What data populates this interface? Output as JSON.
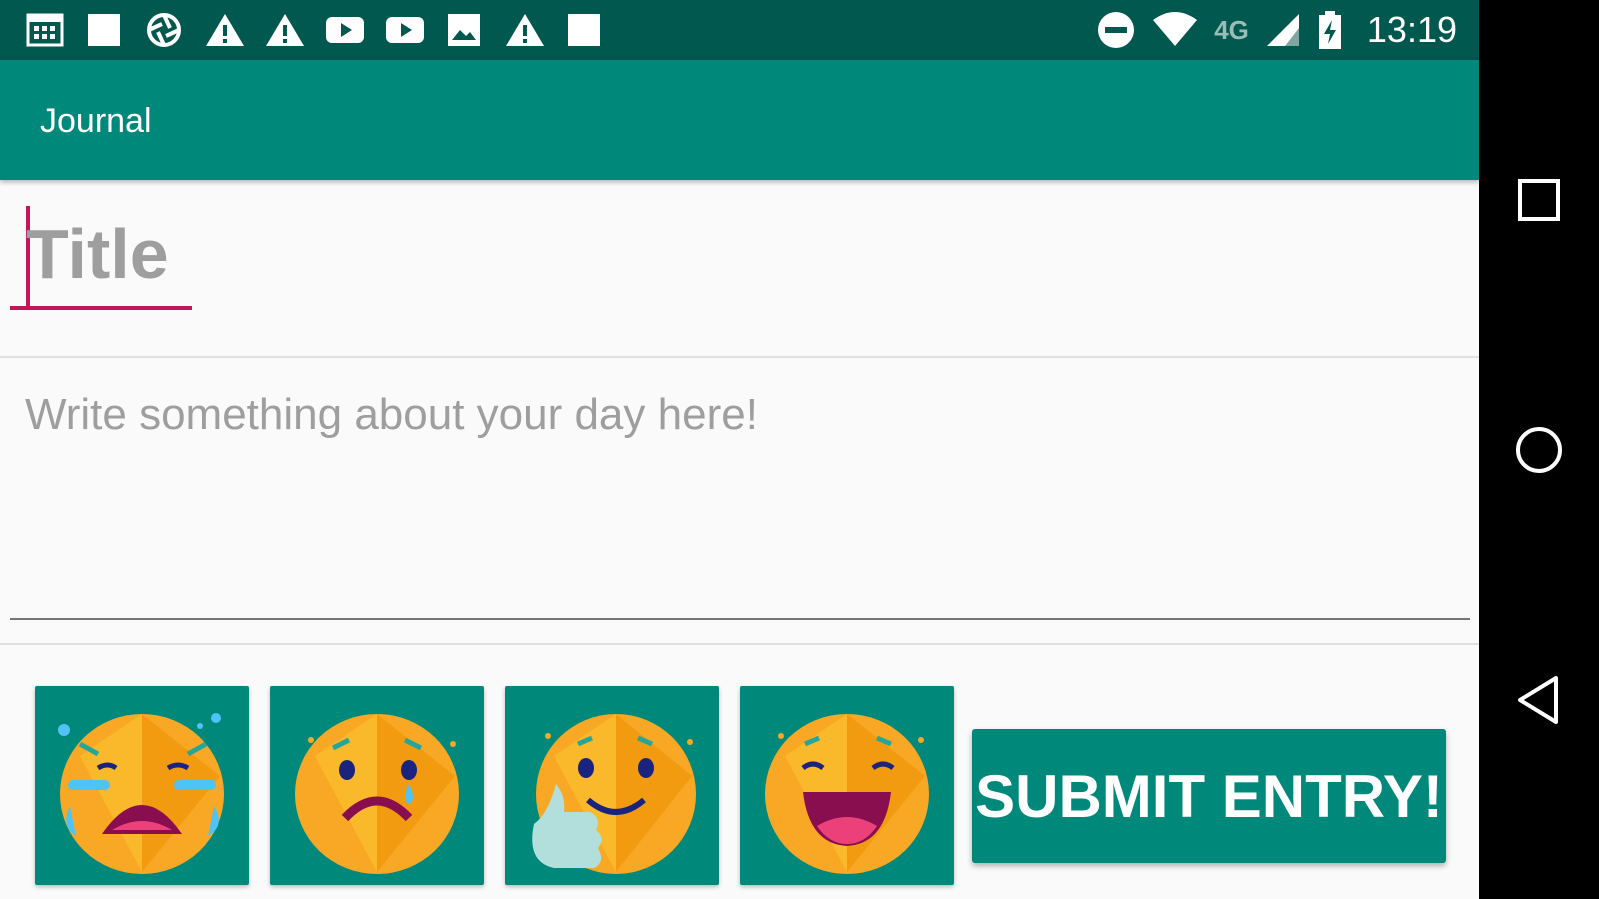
{
  "status_bar": {
    "time": "13:19",
    "network_type": "4G",
    "icons": [
      "calendar-icon",
      "square-notification-icon",
      "aperture-icon",
      "warning-icon",
      "warning-icon",
      "youtube-icon",
      "youtube-icon",
      "image-icon",
      "warning-icon",
      "square-notification-icon",
      "do-not-disturb-icon",
      "wifi-icon",
      "cell-signal-icon",
      "battery-charging-icon"
    ]
  },
  "app_bar": {
    "title": "Journal"
  },
  "form": {
    "title_placeholder": "Title",
    "body_placeholder": "Write something about your day here!"
  },
  "moods": [
    {
      "name": "crying",
      "icon": "crying-face-icon"
    },
    {
      "name": "sad",
      "icon": "sad-face-icon"
    },
    {
      "name": "content",
      "icon": "thumbs-up-smiling-face-icon"
    },
    {
      "name": "happy",
      "icon": "laughing-face-icon"
    }
  ],
  "submit_label": "SUBMIT ENTRY!",
  "nav_bar": {
    "items": [
      "recents-button",
      "home-button",
      "back-button"
    ]
  },
  "colors": {
    "primary": "#00897b",
    "primary_dark": "#00584f",
    "accent": "#c2185b",
    "background": "#fafafa",
    "face": "#f9a825"
  }
}
